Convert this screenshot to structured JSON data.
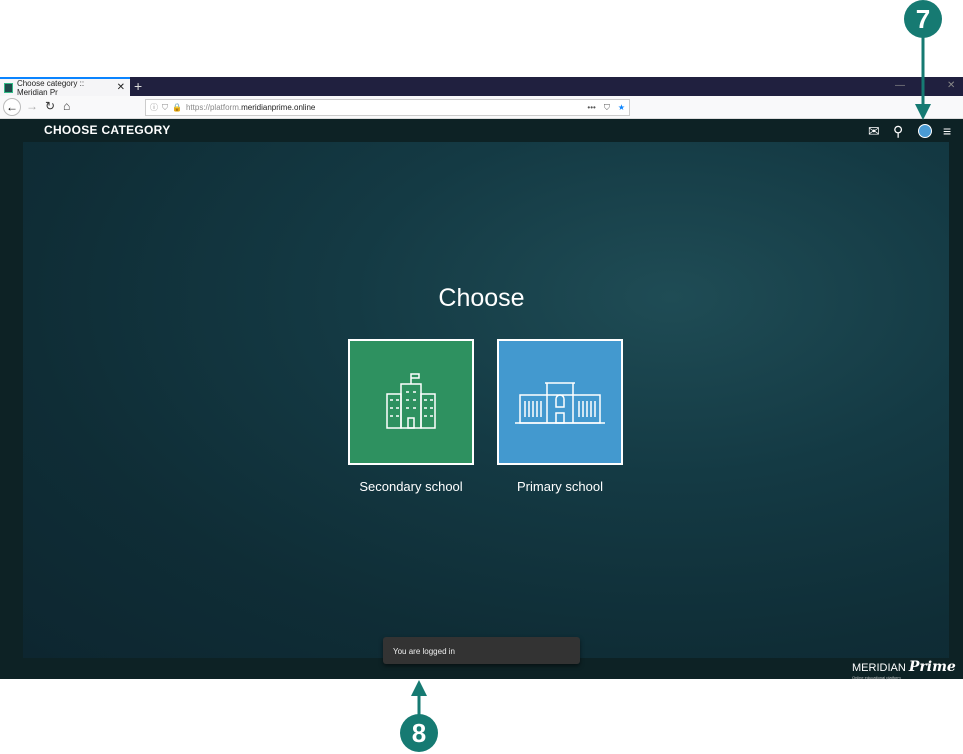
{
  "browser": {
    "tab_title": "Choose category :: Meridian Pr",
    "url_prefix": "https://platform.",
    "url_domain": "meridianprime.online"
  },
  "app": {
    "title": "CHOOSE CATEGORY",
    "heading": "Choose",
    "categories": [
      {
        "label": "Secondary school",
        "color": "#2e9160"
      },
      {
        "label": "Primary school",
        "color": "#4399cf"
      }
    ],
    "toast": "You are logged in",
    "logo": {
      "name": "MERIDIAN",
      "script": "Prime",
      "tagline": "Online educational platform"
    }
  },
  "annotations": [
    "7",
    "8"
  ],
  "colors": {
    "annotation": "#167a72"
  }
}
